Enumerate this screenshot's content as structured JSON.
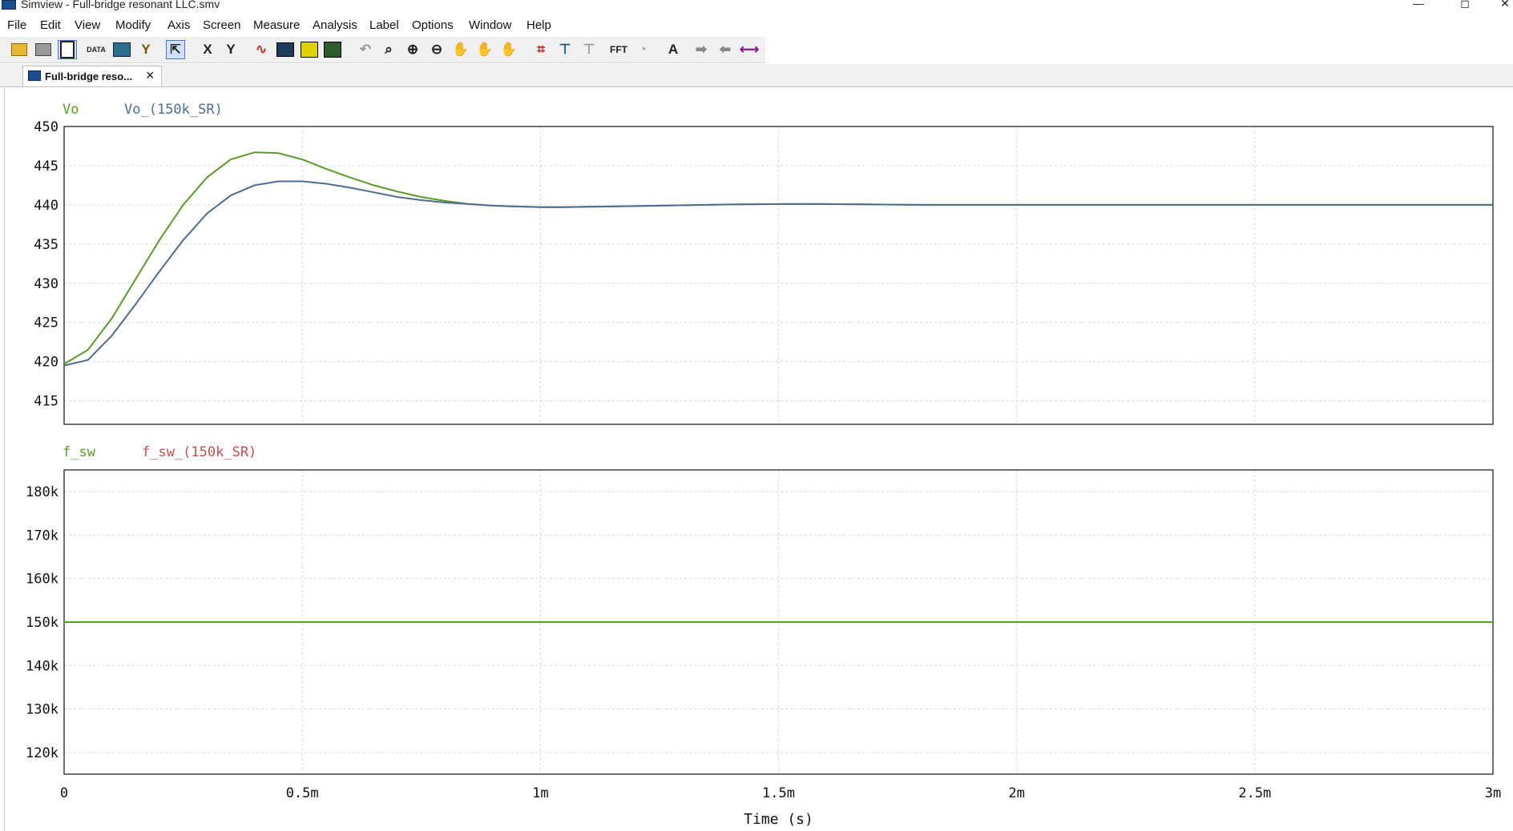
{
  "window": {
    "title": "Simview - Full-bridge resonant LLC.smv",
    "minimize": "—",
    "maximize": "◻",
    "close": "✕"
  },
  "menu": [
    "File",
    "Edit",
    "View",
    "Modify",
    "Axis",
    "Screen",
    "Measure",
    "Analysis",
    "Label",
    "Options",
    "Window",
    "Help"
  ],
  "toolbar": {
    "icons": [
      "open-icon",
      "print-icon",
      "copy-icon",
      "data-icon",
      "disk-icon",
      "add-curve-icon",
      "y-axis-icon",
      "select-cursor-icon",
      "x-axis-icon",
      "y-label-icon",
      "waveform-icon",
      "min-max-icon",
      "grid-icon",
      "multi-plot-icon",
      "undo-icon",
      "zoom-icon",
      "zoom-in-icon",
      "zoom-out-icon",
      "pan-icon",
      "pan-x-icon",
      "pan-y-icon",
      "crosshair-icon",
      "marker-icon",
      "marker-off-icon",
      "fft-icon",
      "clock-icon",
      "text-icon",
      "arrow-right-icon",
      "arrow-left-icon",
      "arrow-both-icon"
    ],
    "fft_label": "FFT",
    "data_label": "DATA",
    "text_label": "A",
    "x_label": "X",
    "y_label": "Y"
  },
  "tab": {
    "label": "Full-bridge reso...",
    "close": "×"
  },
  "chart_data": [
    {
      "type": "line",
      "xlim": [
        0,
        0.003
      ],
      "ylim": [
        412,
        450
      ],
      "yticks": [
        450,
        445,
        440,
        435,
        430,
        425,
        420,
        415
      ],
      "ytick_labels": [
        "450",
        "445",
        "440",
        "435",
        "430",
        "425",
        "420",
        "415"
      ],
      "grid": true,
      "series": [
        {
          "name": "Vo",
          "color": "#5a9a2a",
          "x": [
            0,
            5e-05,
            0.0001,
            0.00015,
            0.0002,
            0.00025,
            0.0003,
            0.00035,
            0.0004,
            0.00045,
            0.0005,
            0.00055,
            0.0006,
            0.00065,
            0.0007,
            0.00075,
            0.0008,
            0.00085,
            0.0009,
            0.00095,
            0.001,
            0.00105,
            0.0011,
            0.0012,
            0.0013,
            0.0014,
            0.0015,
            0.0016,
            0.0017,
            0.0018,
            0.002,
            0.0022,
            0.0024,
            0.0026,
            0.0028,
            0.003
          ],
          "y": [
            419.7,
            421.5,
            425.5,
            430.5,
            435.5,
            440.0,
            443.5,
            445.8,
            446.7,
            446.6,
            445.8,
            444.6,
            443.5,
            442.5,
            441.7,
            441.0,
            440.5,
            440.1,
            439.9,
            439.8,
            439.7,
            439.7,
            439.75,
            439.85,
            439.95,
            440.05,
            440.1,
            440.1,
            440.05,
            440.0,
            440.0,
            440.0,
            440.0,
            440.0,
            440.0,
            440.0
          ]
        },
        {
          "name": "Vo_(150k_SR)",
          "color": "#4f6b8f",
          "x": [
            0,
            5e-05,
            0.0001,
            0.00015,
            0.0002,
            0.00025,
            0.0003,
            0.00035,
            0.0004,
            0.00045,
            0.0005,
            0.00055,
            0.0006,
            0.00065,
            0.0007,
            0.00075,
            0.0008,
            0.00085,
            0.0009,
            0.00095,
            0.001,
            0.00105,
            0.0011,
            0.0012,
            0.0013,
            0.0014,
            0.0015,
            0.0016,
            0.0017,
            0.0018,
            0.002,
            0.0022,
            0.0024,
            0.0026,
            0.0028,
            0.003
          ],
          "y": [
            419.5,
            420.2,
            423.3,
            427.3,
            431.5,
            435.5,
            438.9,
            441.2,
            442.5,
            443.0,
            443.0,
            442.7,
            442.2,
            441.6,
            441.0,
            440.6,
            440.3,
            440.1,
            439.9,
            439.8,
            439.7,
            439.7,
            439.75,
            439.85,
            439.95,
            440.05,
            440.1,
            440.1,
            440.05,
            440.0,
            440.0,
            440.0,
            440.0,
            440.0,
            440.0,
            440.0
          ]
        }
      ]
    },
    {
      "type": "line",
      "xlim": [
        0,
        0.003
      ],
      "ylim": [
        115000,
        185000
      ],
      "yticks": [
        180000,
        170000,
        160000,
        150000,
        140000,
        130000,
        120000
      ],
      "ytick_labels": [
        "180k",
        "170k",
        "160k",
        "150k",
        "140k",
        "130k",
        "120k"
      ],
      "grid": true,
      "series": [
        {
          "name": "f_sw",
          "color": "#5a9a2a",
          "x": [
            0,
            0.003
          ],
          "y": [
            150000,
            150000
          ]
        },
        {
          "name": "f_sw_(150k_SR)",
          "color": "#c05050",
          "x": [
            0,
            0.003
          ],
          "y": [
            150000,
            150000
          ]
        }
      ]
    }
  ],
  "xaxis": {
    "ticks": [
      0,
      0.0005,
      0.001,
      0.0015,
      0.002,
      0.0025,
      0.003
    ],
    "tick_labels": [
      "0",
      "0.5m",
      "1m",
      "1.5m",
      "2m",
      "2.5m",
      "3m"
    ],
    "label": "Time (s)"
  }
}
